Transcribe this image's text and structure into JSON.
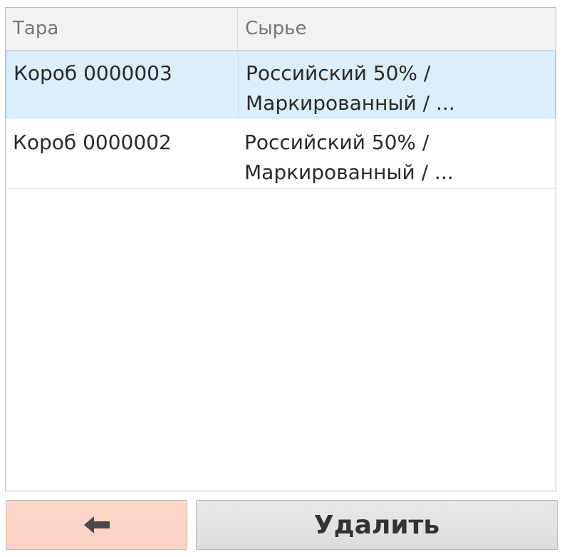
{
  "table": {
    "columns": [
      "Тара",
      "Сырье"
    ],
    "rows": [
      {
        "tara": "Короб 0000003",
        "raw_line1": "Российский 50% /",
        "raw_line2": "Маркированный / ...",
        "selected": true
      },
      {
        "tara": "Короб 0000002",
        "raw_line1": "Российский 50% /",
        "raw_line2": "Маркированный / ...",
        "selected": false
      }
    ]
  },
  "buttons": {
    "back_icon": "arrow-left-icon",
    "delete_label": "Удалить"
  },
  "colors": {
    "selected_row": "#dcedfb",
    "back_button": "#ffd6c9",
    "delete_button": "#e0e0e0"
  }
}
